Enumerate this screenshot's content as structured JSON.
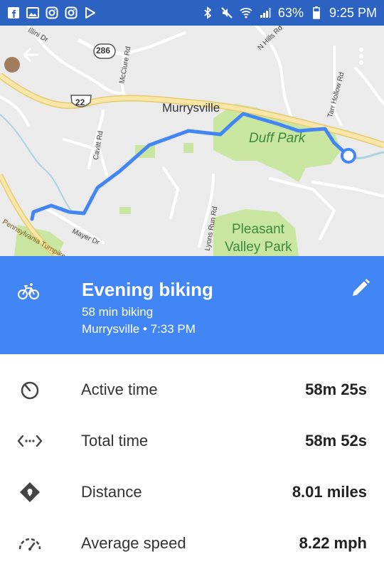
{
  "status_bar": {
    "battery": "63%",
    "time": "9:25 PM"
  },
  "map": {
    "labels": {
      "town": "Murrysville",
      "park1": "Duff Park",
      "park2_line1": "Pleasant",
      "park2_line2": "Valley Park",
      "route_286": "286",
      "route_22": "22",
      "road_illini": "Illini Dr",
      "road_mcclure": "McClure Rd",
      "road_nhills": "N Hills Rd",
      "road_tarr": "Tarr Hollow Rd",
      "road_cavitt": "Cavitt Rd",
      "road_lyons": "Lyons Run Rd",
      "road_mayer": "Mayer Dr",
      "road_pa_turnpike": "Pennsylvania Turnpike"
    },
    "colors": {
      "route": "#4285f4",
      "park": "#c8e6a0",
      "highway": "#f5e3a3"
    }
  },
  "activity": {
    "title": "Evening biking",
    "subtitle": "58 min biking",
    "location_time": "Murrysville • 7:33 PM",
    "icon": "bike-icon"
  },
  "stats": [
    {
      "label": "Active time",
      "value": "58m 25s",
      "icon": "timer-icon"
    },
    {
      "label": "Total time",
      "value": "58m 52s",
      "icon": "duration-icon"
    },
    {
      "label": "Distance",
      "value": "8.01 miles",
      "icon": "distance-pin-icon"
    },
    {
      "label": "Average speed",
      "value": "8.22 mph",
      "icon": "speedometer-icon"
    }
  ],
  "colors": {
    "accent": "#4285f4",
    "statusbar": "#2c63c2"
  }
}
